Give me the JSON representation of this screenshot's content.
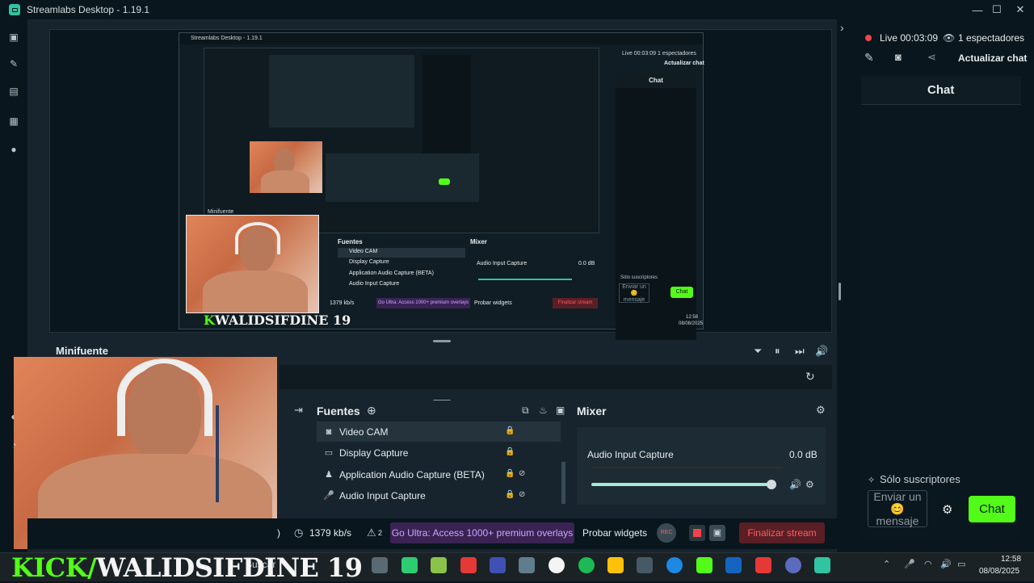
{
  "window": {
    "title": "Streamlabs Desktop - 1.19.1",
    "minimize": "—",
    "maximize": "☐",
    "close": "✕"
  },
  "sidebar": {
    "items": [
      {
        "icon": "editor-icon"
      },
      {
        "icon": "themes-icon"
      },
      {
        "icon": "store-icon"
      },
      {
        "icon": "layout-icon"
      },
      {
        "icon": "play-icon"
      }
    ],
    "expand": "›"
  },
  "preview": {
    "nested": {
      "title": "Streamlabs Desktop - 1.19.1",
      "chat_header": "Chat",
      "live": "Live 00:03:09",
      "viewers": "1 espectadores",
      "refresh_chat": "Actualizar chat",
      "subs_only": "Sólo suscriptores",
      "input_placeholder": "Enviar un 😊 mensaje",
      "chat_button": "Chat",
      "minifuente": "Minifuente",
      "fuentes": "Fuentes",
      "mixer": "Mixer",
      "sources": [
        "Video CAM",
        "Display Capture",
        "Application Audio Capture (BETA)",
        "Audio Input Capture"
      ],
      "mixer_item": "Audio Input Capture",
      "mixer_db": "0.0 dB",
      "bitrate": "1379 kb/s",
      "ultra": "Go Ultra: Access 1000+ premium overlays",
      "test_widgets": "Probar widgets",
      "end_stream": "Finalizar stream",
      "overlay_text": "WALIDSIFDINE 19",
      "clock_time": "12:58",
      "clock_date": "08/08/2025"
    }
  },
  "minifuente": {
    "title": "Minifuente"
  },
  "fuentes": {
    "title": "Fuentes",
    "sources": [
      {
        "name": "Video CAM",
        "icon": "camera-icon"
      },
      {
        "name": "Display Capture",
        "icon": "monitor-icon"
      },
      {
        "name": "Application Audio Capture (BETA)",
        "icon": "user-icon"
      },
      {
        "name": "Audio Input Capture",
        "icon": "mic-icon"
      }
    ]
  },
  "mixer": {
    "title": "Mixer",
    "item": "Audio Input Capture",
    "db": "0.0 dB",
    "volume": 0.94
  },
  "footer": {
    "bitrate": "1379 kb/s",
    "warnings": "2",
    "ultra": "Go Ultra: Access 1000+ premium overlays",
    "test_widgets": "Probar widgets",
    "rec": "REC",
    "end_stream": "Finalizar stream"
  },
  "rightpanel": {
    "live": "Live 00:03:09",
    "viewers": "1 espectadores",
    "refresh_chat": "Actualizar chat",
    "chat_header": "Chat",
    "subs_only": "Sólo suscriptores",
    "input_placeholder": "Enviar un 😊 mensaje",
    "chat_button": "Chat"
  },
  "overlay": {
    "kick": "KICK/",
    "name": "WALIDSIFDINE 19"
  },
  "taskbar": {
    "search_label": "Buscar",
    "time": "12:58",
    "date": "08/08/2025"
  }
}
